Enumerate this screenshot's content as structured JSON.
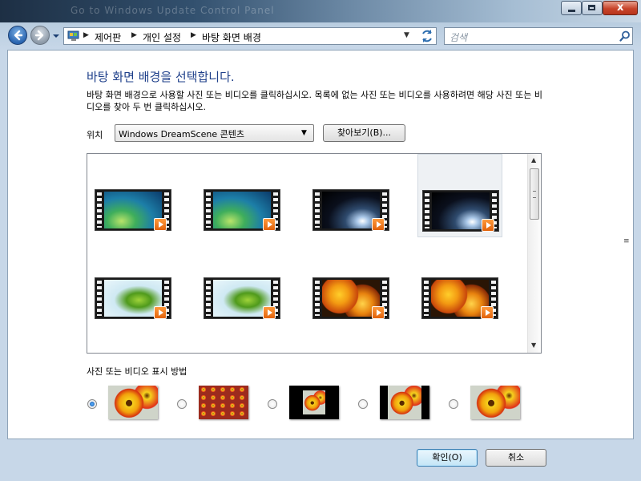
{
  "window": {
    "title_ghost": "Go to Windows Update Control Panel",
    "caption_close": "x"
  },
  "address": {
    "crumbs": [
      "제어판",
      "개인 설정",
      "바탕 화면 배경"
    ],
    "search_placeholder": "검색"
  },
  "page": {
    "heading": "바탕 화면 배경을 선택합니다.",
    "description": "바탕 화면 배경으로 사용할 사진 또는 비디오를 클릭하십시오. 목록에 없는 사진 또는 비디오를 사용하려면 해당 사진 또는 비디오를 찾아 두 번 클릭하십시오.",
    "location_label": "위치",
    "location_value": "Windows DreamScene 콘텐츠",
    "browse_label": "찾아보기(B)..."
  },
  "gallery": {
    "items": [
      {
        "picture": "aurora"
      },
      {
        "picture": "aurora"
      },
      {
        "picture": "space-light"
      },
      {
        "picture": "space-light",
        "selected": true
      },
      {
        "picture": "leaf"
      },
      {
        "picture": "leaf"
      },
      {
        "picture": "autumn-leaves"
      },
      {
        "picture": "autumn-leaves"
      }
    ]
  },
  "position": {
    "label": "사진 또는 비디오 표시 방법",
    "options": [
      {
        "mode": "fill",
        "checked": true
      },
      {
        "mode": "tile",
        "checked": false
      },
      {
        "mode": "center",
        "checked": false
      },
      {
        "mode": "fit",
        "checked": false
      },
      {
        "mode": "stretch",
        "checked": false
      }
    ]
  },
  "footer": {
    "ok_label": "확인(O)",
    "cancel_label": "취소"
  },
  "colors": {
    "heading_blue": "#1e3f8a",
    "selection_bg": "#eef1f4",
    "ok_border": "#3c7fb1"
  }
}
